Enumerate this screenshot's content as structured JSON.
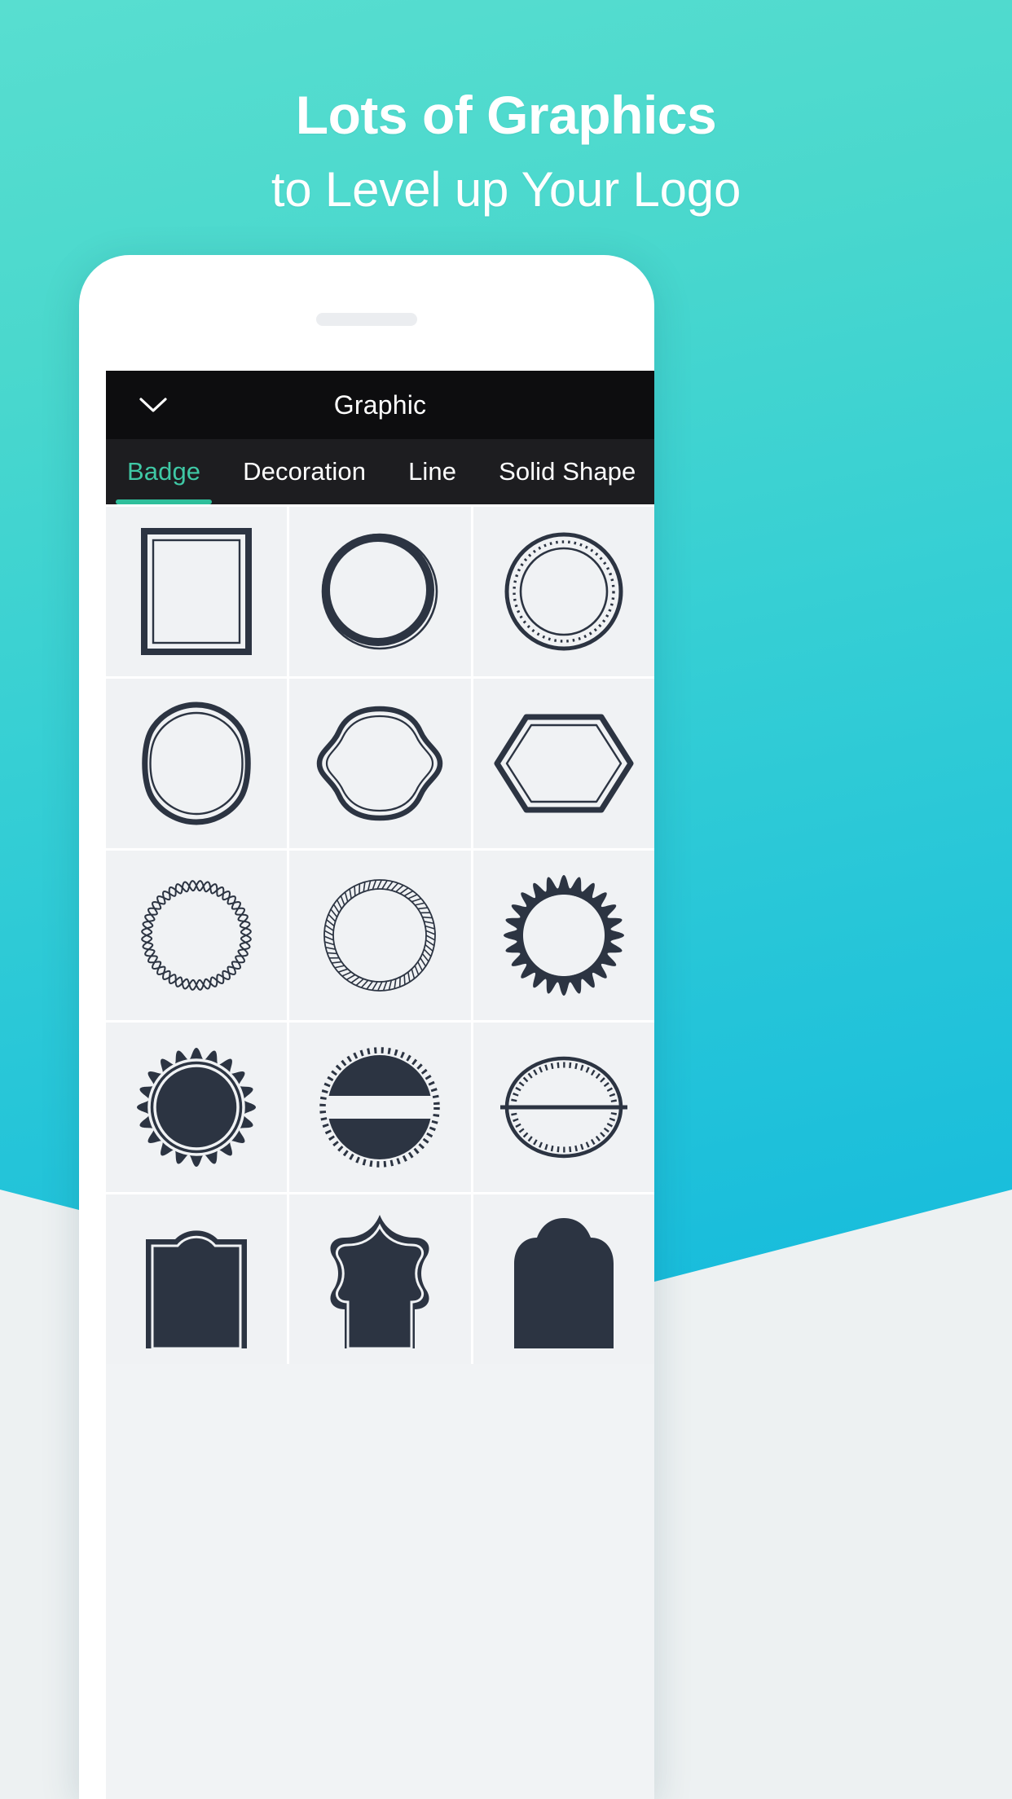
{
  "headline": {
    "line1": "Lots of Graphics",
    "line2": "to Level up Your Logo"
  },
  "colors": {
    "bg_teal_top": "#58ded0",
    "bg_teal_bottom": "#0bb4de",
    "bg_lower": "#edf1f2",
    "header_bg": "#0d0d0f",
    "tabbar_bg": "#1d1d20",
    "tab_active": "#3fc8a5",
    "tab_indicator": "#2fbf9b",
    "cell_bg": "#f0f2f4",
    "shape_ink": "#2c3442",
    "phone_body": "#ffffff",
    "speaker": "#ebedf0"
  },
  "phone": {
    "speaker_name": "earpiece-speaker"
  },
  "app": {
    "header": {
      "collapse_icon": "chevron-down-icon",
      "title": "Graphic"
    },
    "tabs": [
      {
        "label": "Badge",
        "active": true
      },
      {
        "label": "Decoration",
        "active": false
      },
      {
        "label": "Line",
        "active": false
      },
      {
        "label": "Solid Shape",
        "active": false
      }
    ],
    "grid": {
      "columns": 3,
      "items": [
        {
          "row": 1,
          "col": 1,
          "shape": "double-rectangle-frame",
          "style": "outline"
        },
        {
          "row": 1,
          "col": 2,
          "shape": "double-circle-ring",
          "style": "outline"
        },
        {
          "row": 1,
          "col": 3,
          "shape": "dotted-inner-circle-ring",
          "style": "outline"
        },
        {
          "row": 2,
          "col": 1,
          "shape": "rounded-hexagon-double-outline",
          "style": "outline"
        },
        {
          "row": 2,
          "col": 2,
          "shape": "wavy-squircle-double-outline",
          "style": "outline"
        },
        {
          "row": 2,
          "col": 3,
          "shape": "elongated-hexagon-double-outline",
          "style": "outline"
        },
        {
          "row": 3,
          "col": 1,
          "shape": "braided-twist-circle",
          "style": "outline"
        },
        {
          "row": 3,
          "col": 2,
          "shape": "rope-circle",
          "style": "outline"
        },
        {
          "row": 3,
          "col": 3,
          "shape": "scalloped-gear-circle",
          "style": "solid"
        },
        {
          "row": 4,
          "col": 1,
          "shape": "scalloped-solid-badge-double-ring",
          "style": "solid"
        },
        {
          "row": 4,
          "col": 2,
          "shape": "split-banner-circle-dashed",
          "style": "solid"
        },
        {
          "row": 4,
          "col": 3,
          "shape": "split-oval-dotted-outline",
          "style": "outline"
        },
        {
          "row": 5,
          "col": 1,
          "shape": "arched-plaque-solid",
          "style": "solid"
        },
        {
          "row": 5,
          "col": 2,
          "shape": "ornate-bracket-plaque-solid",
          "style": "solid"
        },
        {
          "row": 5,
          "col": 3,
          "shape": "scalloped-crown-plaque-solid",
          "style": "solid"
        }
      ]
    }
  }
}
